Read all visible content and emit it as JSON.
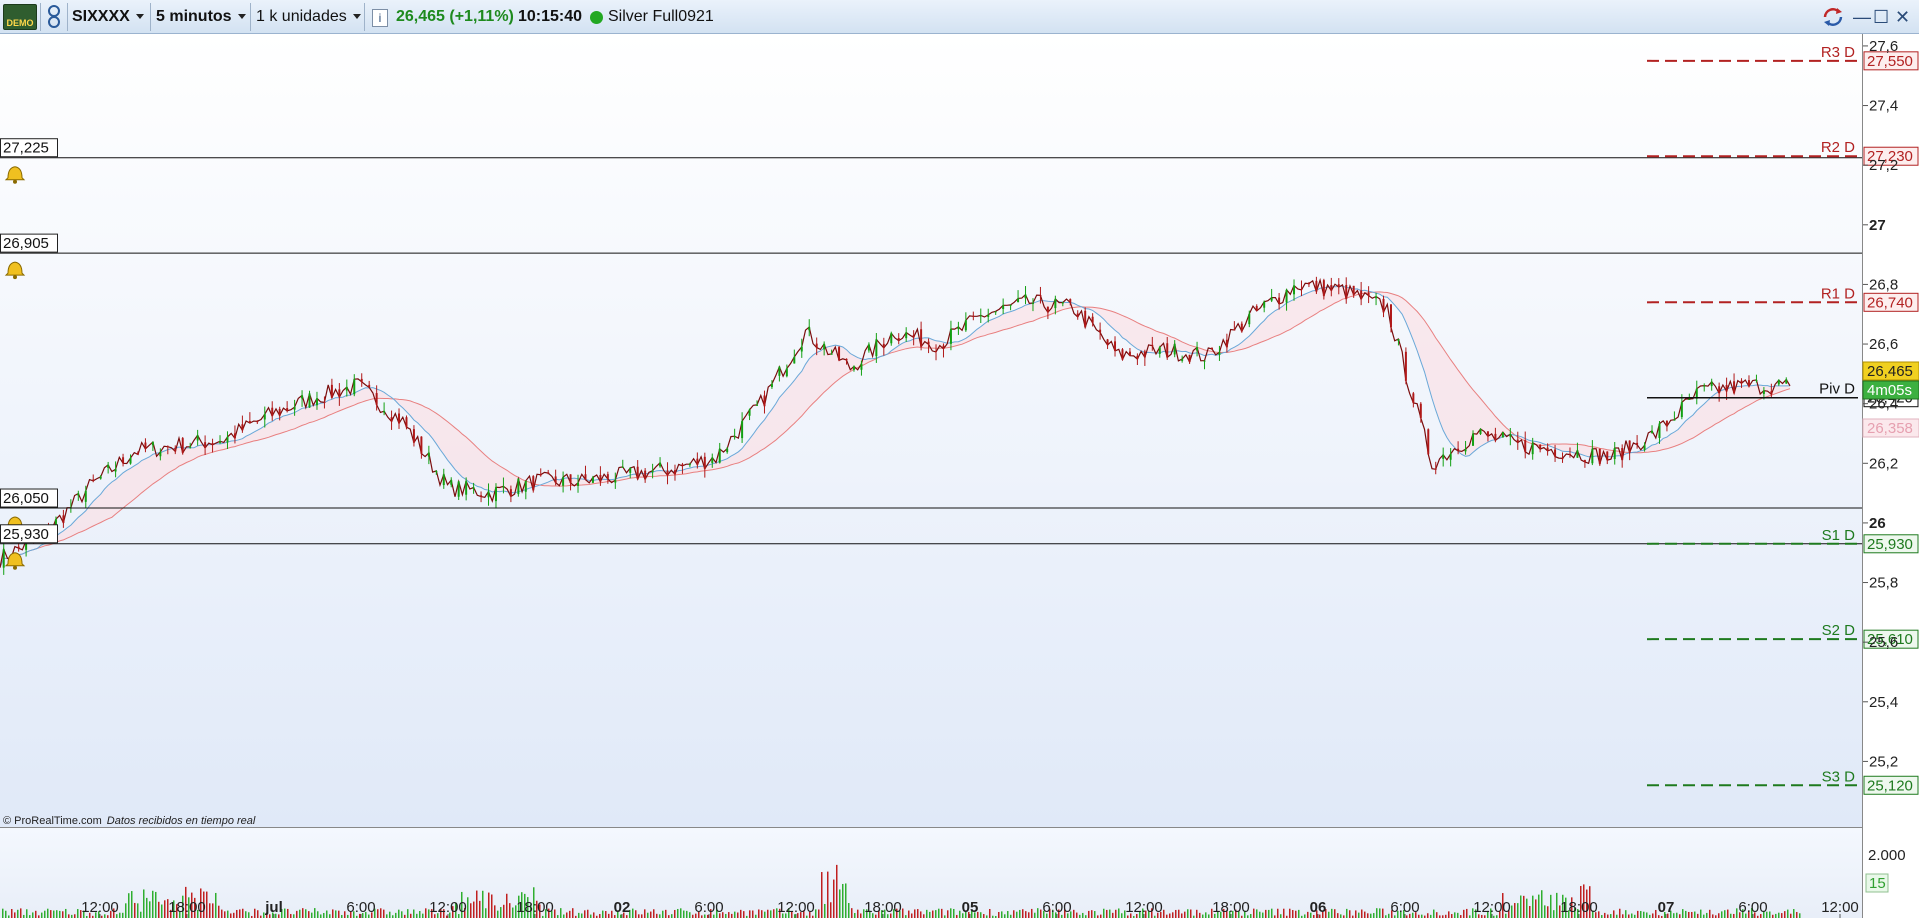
{
  "toolbar": {
    "demo_badge": "DEMO",
    "instrument": "SIXXXX",
    "timeframe": "5 minutos",
    "units": "1 k unidades",
    "price": "26,465 (+1,11%)",
    "time": "10:15:40",
    "account": "Silver Full0921",
    "colors": {
      "price": "#1e8a1e",
      "account_dot": "#22a822"
    }
  },
  "chart": {
    "y_ticks": [
      "27,6",
      "27,4",
      "27,2",
      "27",
      "26,8",
      "26,6",
      "26,4",
      "26,2",
      "26",
      "25,8",
      "25,6",
      "25,4",
      "25,2"
    ],
    "x_ticks": [
      "12:00",
      "18:00",
      "jul",
      "6:00",
      "12:00",
      "18:00",
      "02",
      "6:00",
      "12:00",
      "18:00",
      "05",
      "6:00",
      "12:00",
      "18:00",
      "06",
      "6:00",
      "12:00",
      "18:00",
      "07",
      "6:00",
      "12:00"
    ],
    "pivots": [
      {
        "name": "R3 D",
        "value": "27,550",
        "color": "#b22222"
      },
      {
        "name": "R2 D",
        "value": "27,230",
        "color": "#b22222"
      },
      {
        "name": "R1 D",
        "value": "26,740",
        "color": "#b22222"
      },
      {
        "name": "Piv D",
        "value": "26,420",
        "color": "#111111"
      },
      {
        "name": "S1 D",
        "value": "25,930",
        "color": "#1e7a1e"
      },
      {
        "name": "S2 D",
        "value": "25,610",
        "color": "#1e7a1e"
      },
      {
        "name": "S3 D",
        "value": "25,120",
        "color": "#1e7a1e"
      }
    ],
    "alert_lines": [
      {
        "label": "27,225"
      },
      {
        "label": "26,905"
      },
      {
        "label": "26,050"
      },
      {
        "label": "25,930"
      }
    ],
    "last_price": "26,465",
    "countdown": "4m05s",
    "cloud_value": "26,358",
    "copyright": "© ProRealTime.com",
    "data_note": "Datos recibidos en tiempo real",
    "volume_tick": "2.000",
    "volume_last": "15",
    "colors": {
      "up": "#12a012",
      "down": "#b01818",
      "price_line": "#7a0c0c",
      "tenkan": "#6aa8d8",
      "kijun": "#e88080"
    }
  },
  "chart_data": {
    "type": "line",
    "series": [
      {
        "values": [
          25.88,
          25.96,
          26.12,
          26.24,
          26.26,
          26.28,
          26.36,
          26.42,
          26.46,
          26.34,
          26.12,
          26.1,
          26.14,
          26.14,
          26.16,
          26.18,
          26.22,
          26.4,
          26.64,
          26.52,
          26.64,
          26.6,
          26.7,
          26.74,
          26.72,
          26.56,
          26.58,
          26.56,
          26.7,
          26.8,
          26.78,
          26.72,
          26.2,
          26.3,
          26.26,
          26.24,
          26.22,
          26.3,
          26.44,
          26.46,
          26.46
        ]
      }
    ],
    "ylim": [
      24.98,
      27.64
    ]
  }
}
